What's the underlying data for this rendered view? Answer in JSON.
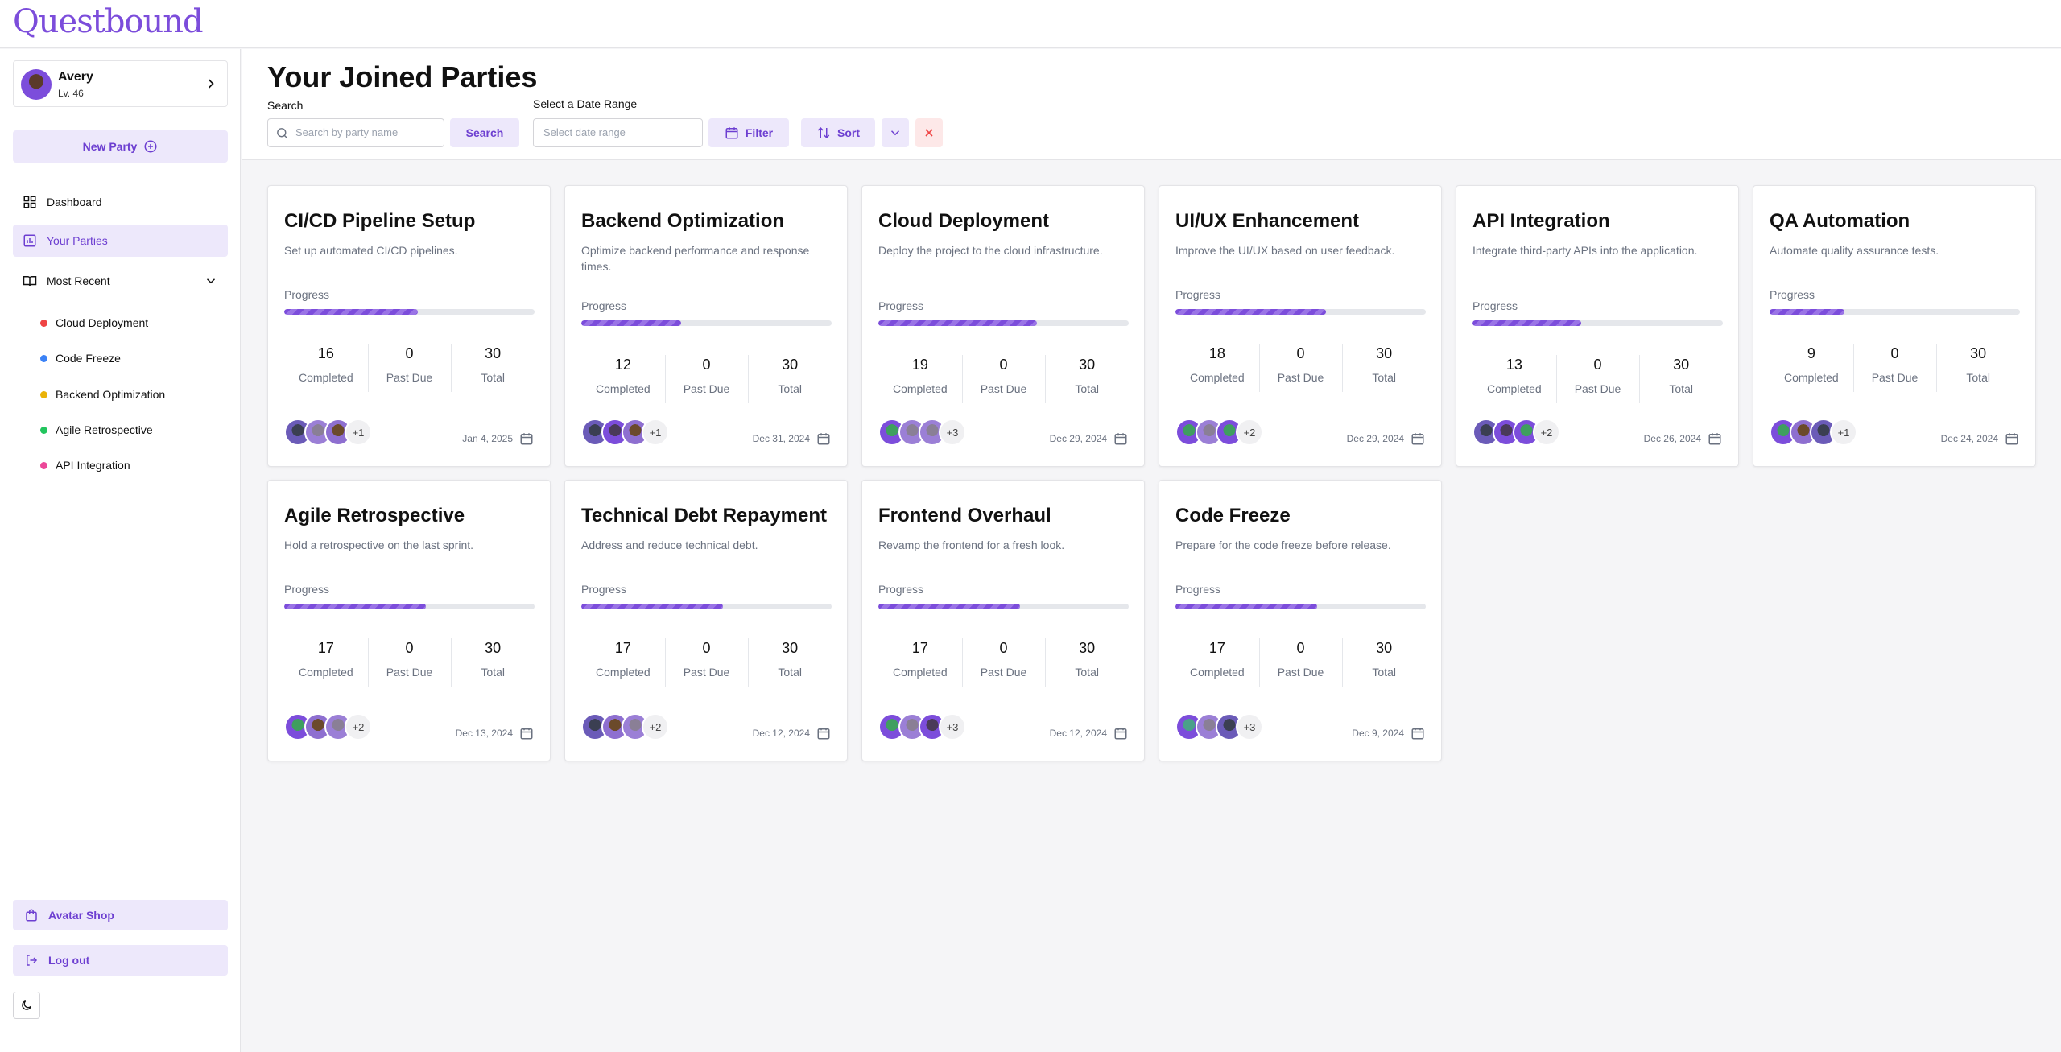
{
  "app": {
    "logo": "Questbound"
  },
  "user": {
    "name": "Avery",
    "level": "Lv. 46"
  },
  "sidebar": {
    "new_party": "New Party",
    "nav": [
      {
        "label": "Dashboard"
      },
      {
        "label": "Your Parties",
        "active": true
      },
      {
        "label": "Most Recent"
      }
    ],
    "recent": [
      {
        "label": "Cloud Deployment",
        "color": "#ef4444"
      },
      {
        "label": "Code Freeze",
        "color": "#3b82f6"
      },
      {
        "label": "Backend Optimization",
        "color": "#eab308"
      },
      {
        "label": "Agile Retrospective",
        "color": "#22c55e"
      },
      {
        "label": "API Integration",
        "color": "#ec4899"
      }
    ],
    "avatar_shop": "Avatar Shop",
    "logout": "Log out"
  },
  "header": {
    "title": "Your Joined Parties",
    "search_label": "Search",
    "search_placeholder": "Search by party name",
    "search_button": "Search",
    "date_label": "Select a Date Range",
    "date_placeholder": "Select date range",
    "filter": "Filter",
    "sort": "Sort"
  },
  "labels": {
    "progress": "Progress",
    "completed": "Completed",
    "past_due": "Past Due",
    "total": "Total"
  },
  "accent_color": "#7c4ddb",
  "cards": [
    {
      "title": "CI/CD Pipeline Setup",
      "desc": "Set up automated CI/CD pipelines.",
      "progress": 0.533,
      "completed": "16",
      "past_due": "0",
      "total": "30",
      "members": "+1",
      "date": "Jan 4, 2025"
    },
    {
      "title": "Backend Optimization",
      "desc": "Optimize backend performance and response times.",
      "progress": 0.4,
      "completed": "12",
      "past_due": "0",
      "total": "30",
      "members": "+1",
      "date": "Dec 31, 2024"
    },
    {
      "title": "Cloud Deployment",
      "desc": "Deploy the project to the cloud infrastructure.",
      "progress": 0.633,
      "completed": "19",
      "past_due": "0",
      "total": "30",
      "members": "+3",
      "date": "Dec 29, 2024"
    },
    {
      "title": "UI/UX Enhancement",
      "desc": "Improve the UI/UX based on user feedback.",
      "progress": 0.6,
      "completed": "18",
      "past_due": "0",
      "total": "30",
      "members": "+2",
      "date": "Dec 29, 2024"
    },
    {
      "title": "API Integration",
      "desc": "Integrate third-party APIs into the application.",
      "progress": 0.433,
      "completed": "13",
      "past_due": "0",
      "total": "30",
      "members": "+2",
      "date": "Dec 26, 2024"
    },
    {
      "title": "QA Automation",
      "desc": "Automate quality assurance tests.",
      "progress": 0.3,
      "completed": "9",
      "past_due": "0",
      "total": "30",
      "members": "+1",
      "date": "Dec 24, 2024"
    },
    {
      "title": "Agile Retrospective",
      "desc": "Hold a retrospective on the last sprint.",
      "progress": 0.567,
      "completed": "17",
      "past_due": "0",
      "total": "30",
      "members": "+2",
      "date": "Dec 13, 2024"
    },
    {
      "title": "Technical Debt Repayment",
      "desc": "Address and reduce technical debt.",
      "progress": 0.567,
      "completed": "17",
      "past_due": "0",
      "total": "30",
      "members": "+2",
      "date": "Dec 12, 2024"
    },
    {
      "title": "Frontend Overhaul",
      "desc": "Revamp the frontend for a fresh look.",
      "progress": 0.567,
      "completed": "17",
      "past_due": "0",
      "total": "30",
      "members": "+3",
      "date": "Dec 12, 2024"
    },
    {
      "title": "Code Freeze",
      "desc": "Prepare for the code freeze before release.",
      "progress": 0.567,
      "completed": "17",
      "past_due": "0",
      "total": "30",
      "members": "+3",
      "date": "Dec 9, 2024"
    }
  ]
}
